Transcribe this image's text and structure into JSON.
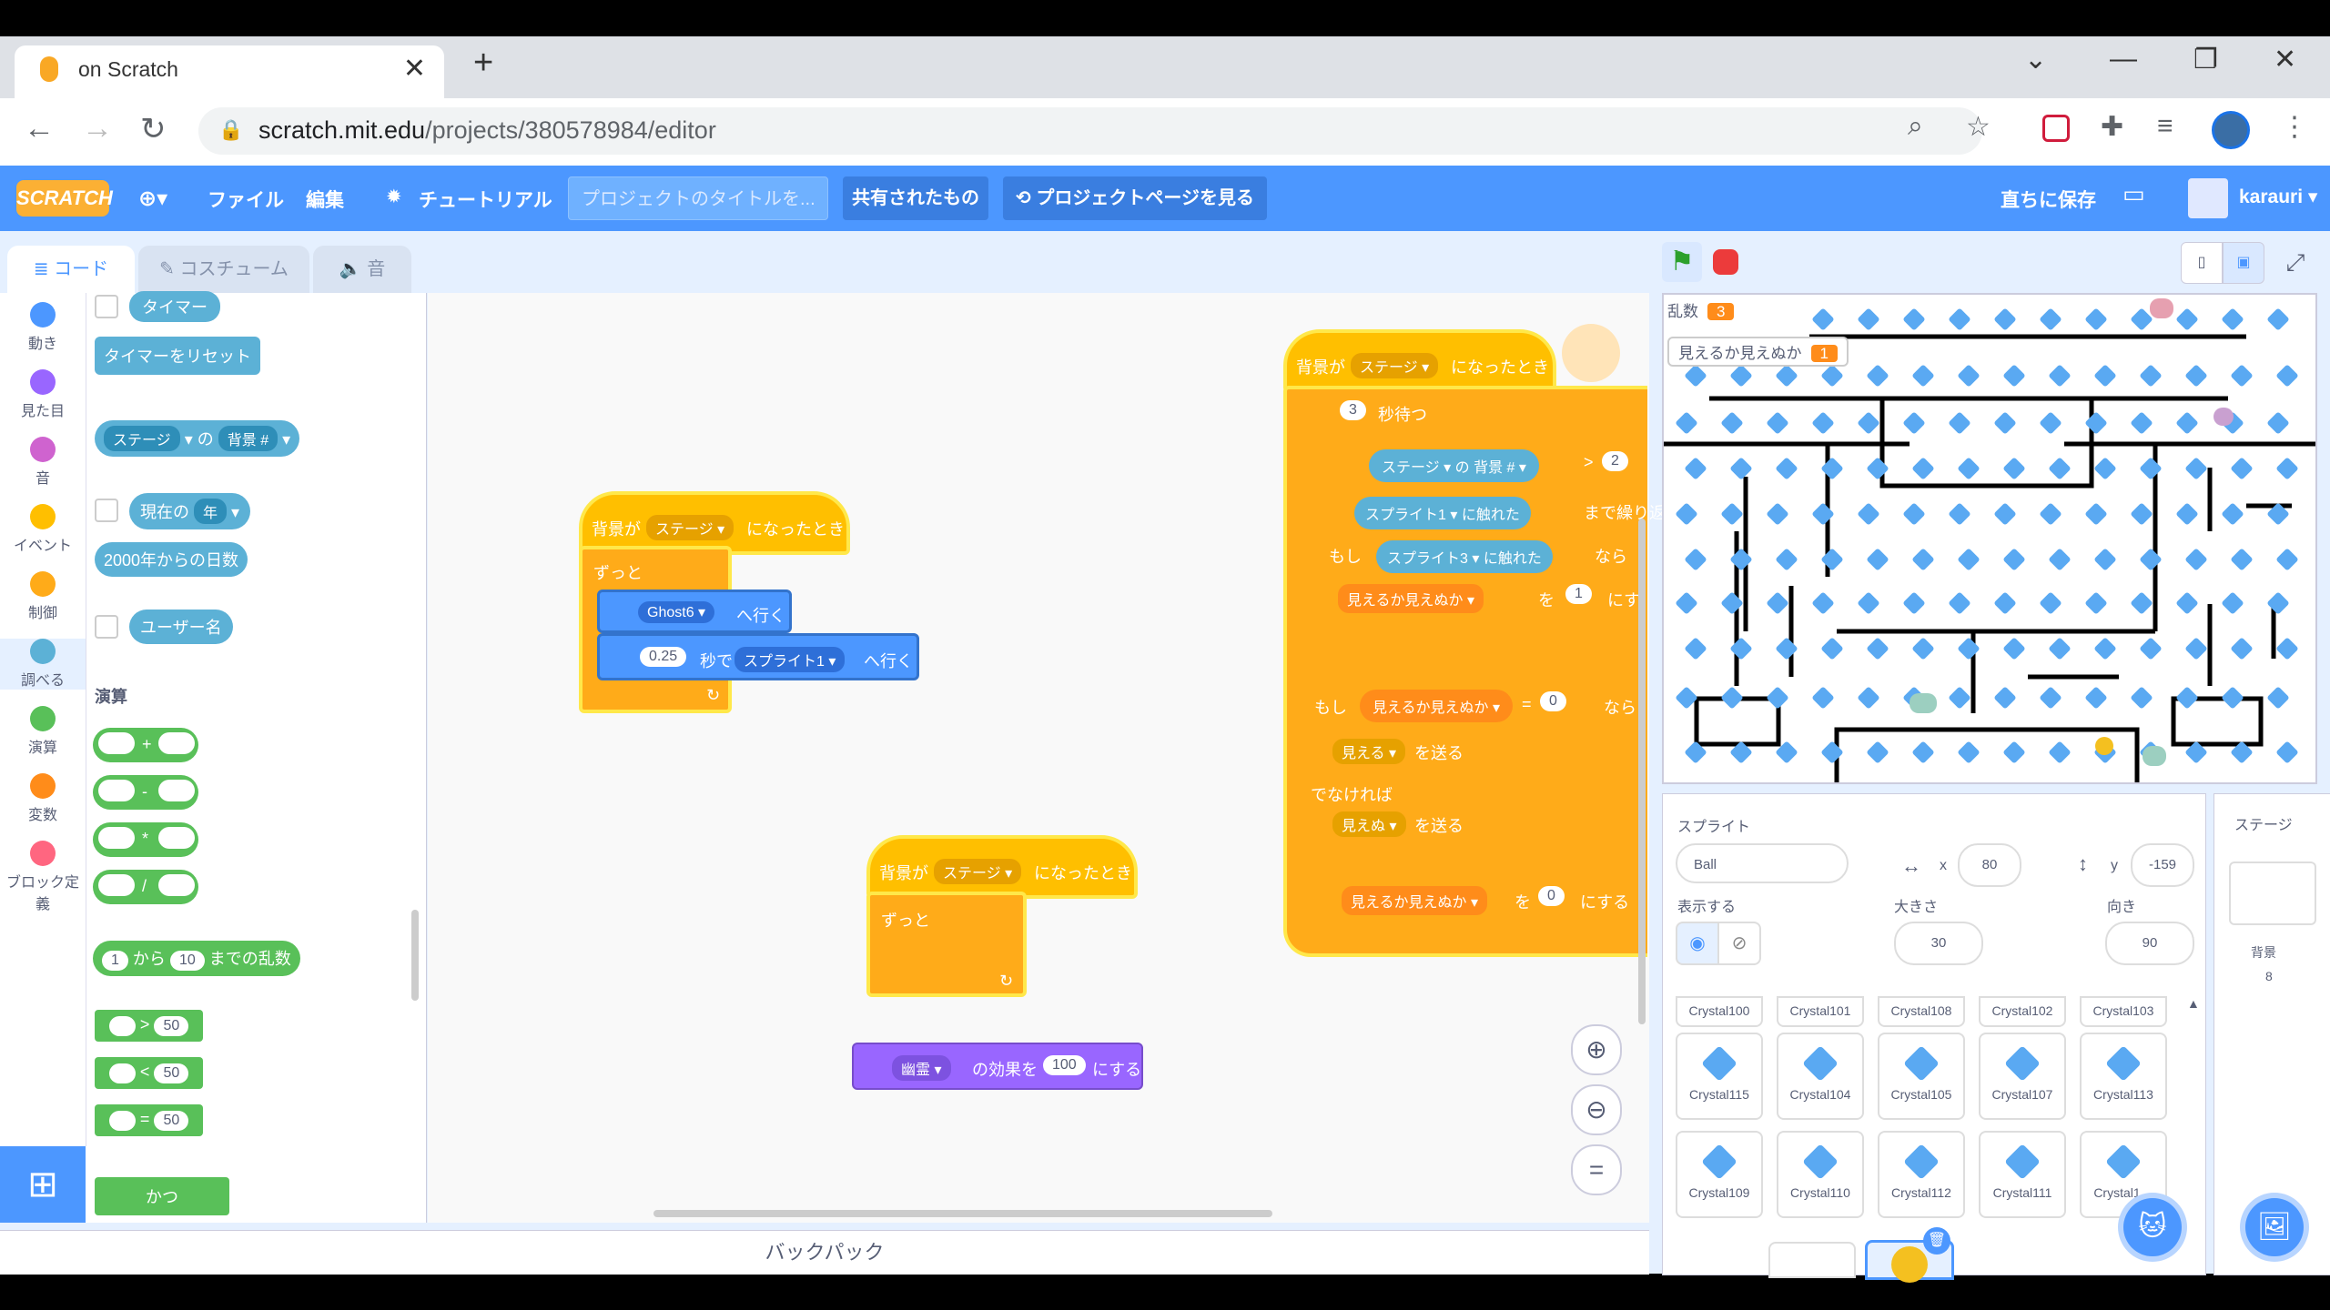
{
  "browser": {
    "tab_title": "on Scratch",
    "url_host": "scratch.mit.edu",
    "url_path": "/projects/380578984/editor"
  },
  "menu": {
    "logo": "SCRATCH",
    "file": "ファイル",
    "edit": "編集",
    "tutorial": "チュートリアル",
    "title_placeholder": "プロジェクトのタイトルを...",
    "shared": "共有されたもの",
    "project_page": "プロジェクトページを見る",
    "save_now": "直ちに保存",
    "user": "karauri"
  },
  "editor_tabs": {
    "code": "コード",
    "costume": "コスチューム",
    "sound": "音"
  },
  "categories": [
    "動き",
    "見た目",
    "音",
    "イベント",
    "制御",
    "調べる",
    "演算",
    "変数",
    "ブロック定義"
  ],
  "category_colors": [
    "#4c97ff",
    "#9966ff",
    "#cf63cf",
    "#ffbf00",
    "#ffab19",
    "#5cb1d6",
    "#59c059",
    "#ff8c1a",
    "#ff6680"
  ],
  "palette": {
    "timer": "タイマー",
    "reset_timer": "タイマーをリセット",
    "stage": "ステージ",
    "of": "の",
    "backdrop_num": "背景 #",
    "current": "現在の",
    "year": "年",
    "days_since": "2000年からの日数",
    "username": "ユーザー名",
    "operators_title": "演算",
    "plus": "+",
    "minus": "-",
    "times": "*",
    "divide": "/",
    "rand_from": "1",
    "rand_kara": "から",
    "rand_to": "10",
    "rand_label": "までの乱数",
    "gt_val": "50",
    "lt_val": "50",
    "eq_val": "50",
    "gt": ">",
    "lt": "<",
    "eq": "=",
    "and": "かつ"
  },
  "script1": {
    "hat_label": "背景が",
    "hat_stage": "ステージ",
    "hat_when": "になったとき",
    "forever": "ずっと",
    "goto_target": "Ghost6",
    "goto": "へ行く",
    "glide_secs": "0.25",
    "glide_sec_label": "秒で",
    "glide_target": "スプライト1",
    "glide_goto": "へ行く"
  },
  "script2": {
    "hat_label": "背景が",
    "hat_stage": "ステージ",
    "hat_when": "になったとき",
    "forever": "ずっと"
  },
  "script3": {
    "ghost_effect": "幽霊",
    "effect_label": "の効果を",
    "value": "100",
    "set": "にする"
  },
  "script4": {
    "hat_label": "背景が",
    "hat_stage": "ステージ",
    "hat_when": "になったとき",
    "wait_num": "3",
    "wait_label": "秒待つ",
    "stage": "ステージ",
    "of": "の",
    "backdrop_num": "背景 #",
    "gt": ">",
    "gt_val": "2",
    "touch1_target": "スプライト1",
    "touch1_label": "に触れた",
    "repeat_until": "まで繰り返",
    "if": "もし",
    "touch3_target": "スプライト3",
    "touch3_label": "に触れた",
    "then": "なら",
    "var_name": "見えるか見えぬか",
    "wo": "を",
    "set_val": "1",
    "set_to": "にす",
    "if2": "もし",
    "eq": "=",
    "eq_val": "0",
    "then2": "なら",
    "bcast_visible": "見える",
    "send": "を送る",
    "else": "でなければ",
    "bcast_invisible": "見えぬ",
    "send2": "を送る",
    "final_wo": "を",
    "final_val": "0",
    "final_set": "にする"
  },
  "stage": {
    "mon1_name": "乱数",
    "mon1_val": "3",
    "mon2_name": "見えるか見えぬか",
    "mon2_val": "1"
  },
  "sprite_info": {
    "title": "スプライト",
    "name": "Ball",
    "x_label": "x",
    "x": "80",
    "y_label": "y",
    "y": "-159",
    "show": "表示する",
    "size_label": "大きさ",
    "size": "30",
    "direction_label": "向き",
    "direction": "90"
  },
  "sprites_row1": [
    "Crystal100",
    "Crystal101",
    "Crystal108",
    "Crystal102",
    "Crystal103"
  ],
  "sprites_row2": [
    "Crystal115",
    "Crystal104",
    "Crystal105",
    "Crystal107",
    "Crystal113"
  ],
  "sprites_row3": [
    "Crystal109",
    "Crystal110",
    "Crystal112",
    "Crystal111",
    "Crystal1…"
  ],
  "stage_pane": {
    "title": "ステージ",
    "backdrop": "背景",
    "count": "8"
  },
  "backpack": "バックパック"
}
